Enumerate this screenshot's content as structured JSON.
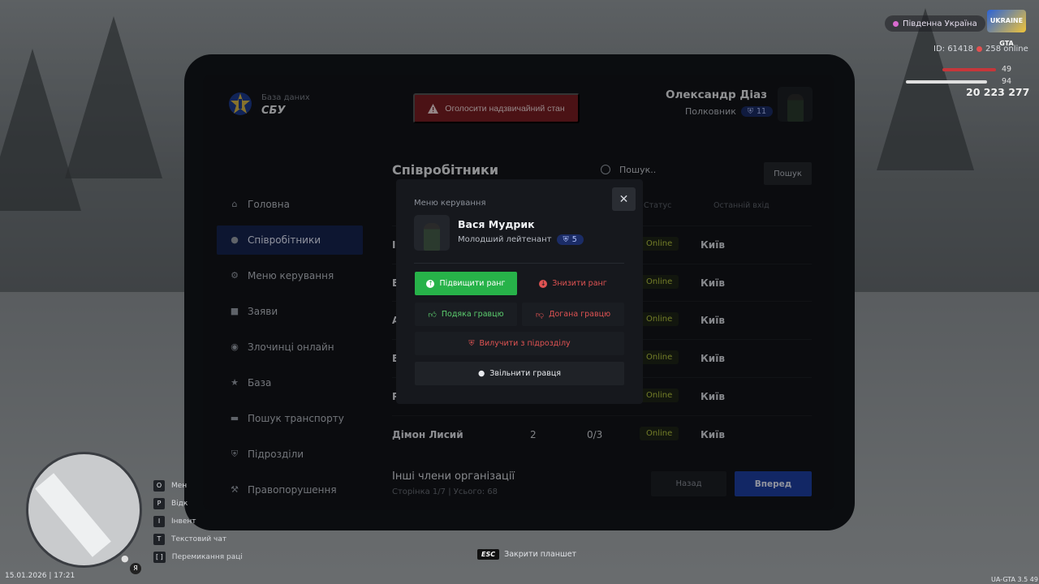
{
  "app": {
    "db_label": "База даних",
    "db_title": "СБУ",
    "emergency_button": "Оголосити надзвичайний стан"
  },
  "user": {
    "name": "Олександр Діаз",
    "rank": "Полковник",
    "rank_level": "11"
  },
  "sidebar": {
    "items": [
      {
        "label": "Головна",
        "icon": "home-icon"
      },
      {
        "label": "Співробітники",
        "icon": "users-icon",
        "active": true
      },
      {
        "label": "Меню керування",
        "icon": "gear-icon"
      },
      {
        "label": "Заяви",
        "icon": "folder-icon"
      },
      {
        "label": "Злочинці онлайн",
        "icon": "mask-icon"
      },
      {
        "label": "База",
        "icon": "star-icon"
      },
      {
        "label": "Пошук транспорту",
        "icon": "car-icon"
      },
      {
        "label": "Підрозділи",
        "icon": "shield-icon"
      },
      {
        "label": "Правопорушення",
        "icon": "gavel-icon"
      }
    ]
  },
  "main": {
    "title": "Співробітники",
    "search_placeholder": "Пошук..",
    "search_button": "Пошук",
    "columns": {
      "status": "Статус",
      "last_login": "Останній вхід"
    },
    "rows": [
      {
        "name": "I",
        "rank": "",
        "warns": "",
        "status": "Online",
        "city": "Київ"
      },
      {
        "name": "E",
        "rank": "",
        "warns": "",
        "status": "Online",
        "city": "Київ"
      },
      {
        "name": "A",
        "rank": "",
        "warns": "",
        "status": "Online",
        "city": "Київ"
      },
      {
        "name": "E",
        "rank": "",
        "warns": "",
        "status": "Online",
        "city": "Київ"
      },
      {
        "name": "P",
        "rank": "",
        "warns": "",
        "status": "Online",
        "city": "Київ"
      },
      {
        "name": "Дімон Лисий",
        "rank": "2",
        "warns": "0/3",
        "status": "Online",
        "city": "Київ"
      }
    ],
    "others_title": "Інші члени організації",
    "others_sub": "Сторінка 1/7 | Усього: 68",
    "back_button": "Назад",
    "next_button": "Вперед"
  },
  "modal": {
    "header": "Меню керування",
    "name": "Вася Мудрик",
    "rank": "Молодший лейтенант",
    "rank_level": "5",
    "actions": {
      "promote": "Підвищити ранг",
      "demote": "Знизити ранг",
      "thanks": "Подяка гравцю",
      "reprimand": "Догана гравцю",
      "exclude": "Вилучити з підрозділу",
      "fire": "Звільнити гравця"
    }
  },
  "hud": {
    "region": "Південна Україна",
    "server_logo": "UKRAINE GTA",
    "player_id": "ID: 61418",
    "online": "258 online",
    "health": "49",
    "armor": "94",
    "money": "20 223 277",
    "esc_key": "ESC",
    "esc_label": "Закрити планшет",
    "datetime": "15.01.2026 | 17:21",
    "version": "UA-GTA 3.5",
    "version_suffix": "49",
    "keybinds": [
      {
        "key": "O",
        "label": "Мен"
      },
      {
        "key": "P",
        "label": "Відк"
      },
      {
        "key": "I",
        "label": "Інвент"
      },
      {
        "key": "T",
        "label": "Текстовий чат"
      },
      {
        "key": "[ ]",
        "label": "Перемикання раці"
      }
    ]
  },
  "colors": {
    "accent": "#1d3fa3",
    "active_nav": "#16254f",
    "emergency": "#7a1d22",
    "success": "#27b249",
    "danger": "#e05353",
    "online": "#b8c940"
  }
}
